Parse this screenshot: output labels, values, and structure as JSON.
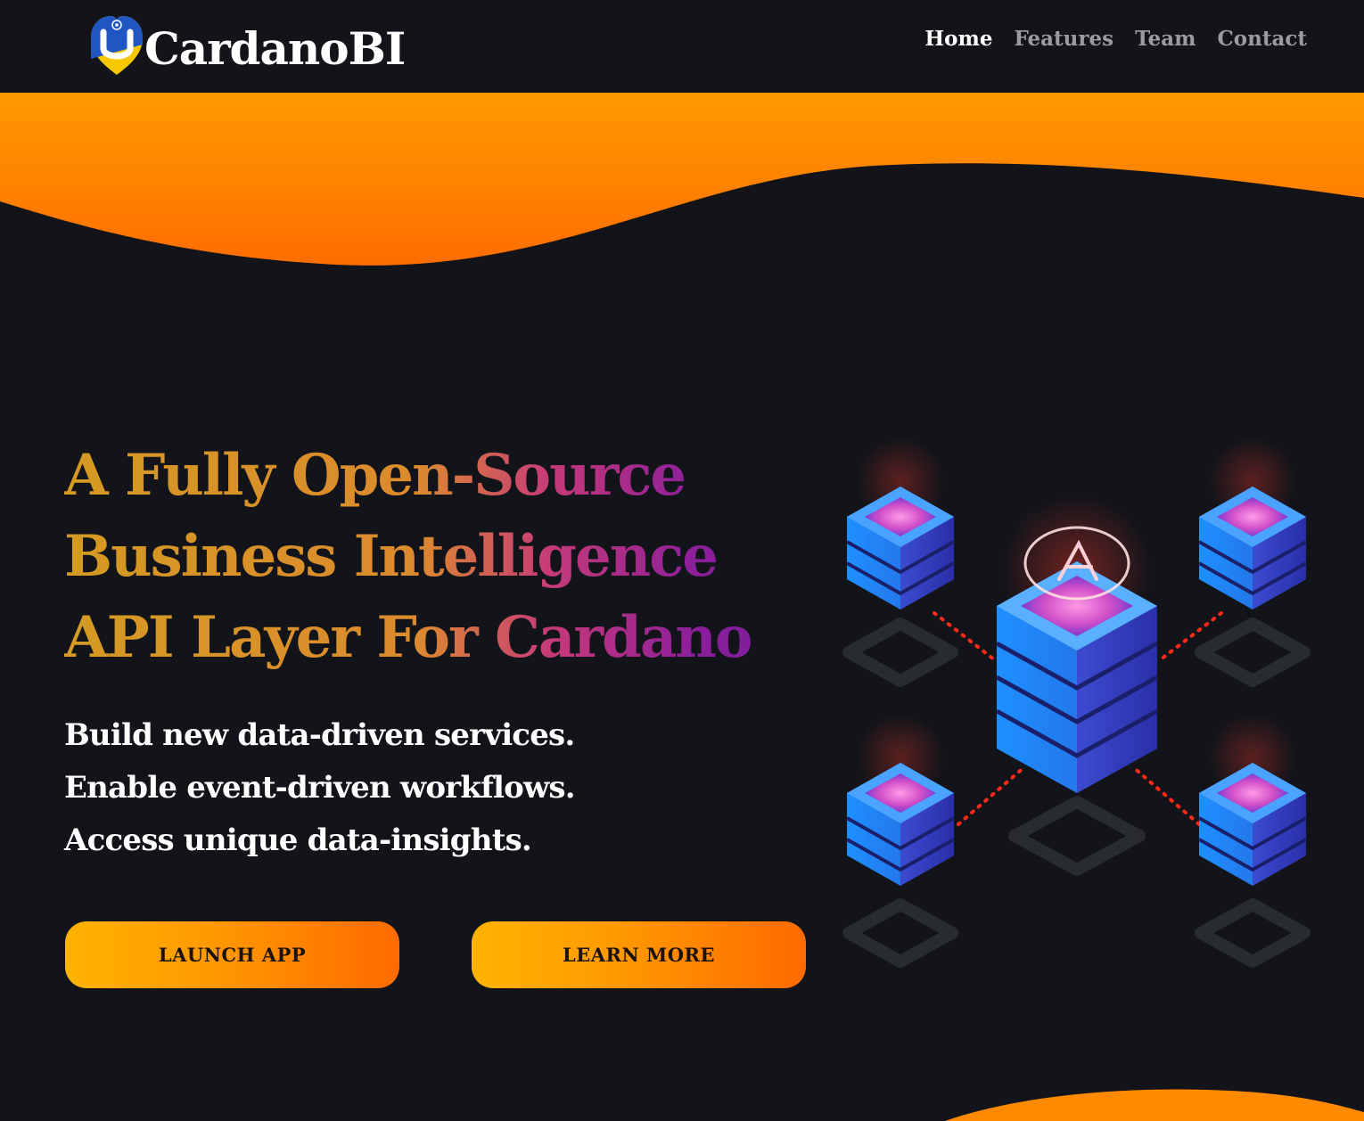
{
  "header": {
    "logo_text": "CardanoBI",
    "nav": [
      {
        "label": "Home",
        "active": true
      },
      {
        "label": "Features",
        "active": false
      },
      {
        "label": "Team",
        "active": false
      },
      {
        "label": "Contact",
        "active": false
      }
    ]
  },
  "hero": {
    "title_lines": [
      "A Fully Open-Source",
      "Business Intelligence",
      "API Layer For Cardano"
    ],
    "subtitle_lines": [
      "Build new data-driven services.",
      "Enable event-driven workflows.",
      "Access unique data-insights."
    ],
    "buttons": {
      "launch": "LAUNCH APP",
      "learn": "LEARN MORE"
    }
  },
  "colors": {
    "background": "#12141a",
    "accent_orange": "#ff9800",
    "nav_inactive": "#9b9ba1",
    "text_white": "#ffffff"
  },
  "icons": {
    "logo": "heart-logo-icon",
    "illustration": "server-network-illustration"
  }
}
